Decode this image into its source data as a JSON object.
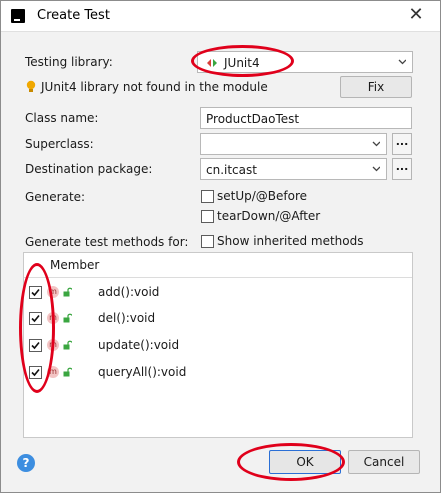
{
  "window": {
    "title": "Create Test",
    "close_glyph": "✕"
  },
  "form": {
    "testing_library_label": "Testing library:",
    "testing_library_value": "JUnit4",
    "warning_text": "JUnit4 library not found in the module",
    "fix_label": "Fix",
    "class_name_label": "Class name:",
    "class_name_value": "ProductDaoTest",
    "superclass_label": "Superclass:",
    "superclass_value": "",
    "destination_label": "Destination package:",
    "destination_value": "cn.itcast",
    "generate_label": "Generate:",
    "setup_label": "setUp/@Before",
    "setup_checked": false,
    "teardown_label": "tearDown/@After",
    "teardown_checked": false,
    "methods_label": "Generate test methods for:",
    "inherited_label": "Show inherited methods",
    "inherited_checked": false,
    "browse_glyph": "..."
  },
  "table": {
    "header": "Member",
    "rows": [
      {
        "name": "add():void",
        "checked": true,
        "icon": "method-icon"
      },
      {
        "name": "del():void",
        "checked": true,
        "icon": "method-icon"
      },
      {
        "name": "update():void",
        "checked": true,
        "icon": "method-icon"
      },
      {
        "name": "queryAll():void",
        "checked": true,
        "icon": "method-icon"
      }
    ],
    "method_icon_letter": "m"
  },
  "footer": {
    "ok_label": "OK",
    "cancel_label": "Cancel",
    "help_glyph": "?"
  },
  "colors": {
    "annotation_red": "#e0001b",
    "warning_bulb": "#f0a800",
    "help_blue": "#3d8ee0",
    "junit_green": "#3aa640",
    "junit_red": "#d9403a"
  }
}
